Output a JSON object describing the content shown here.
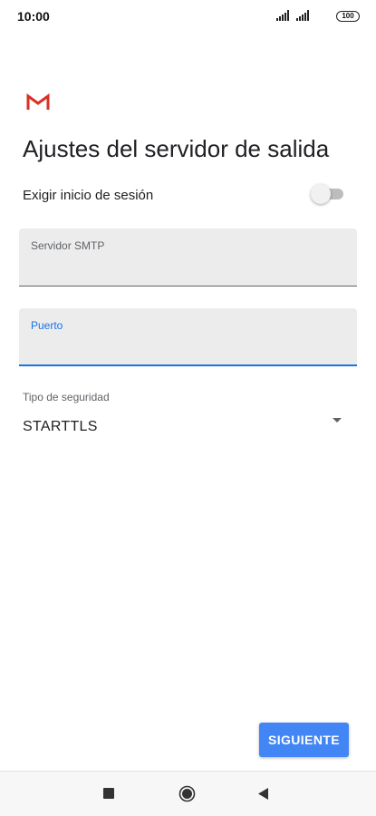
{
  "status_bar": {
    "time": "10:00",
    "battery": "100"
  },
  "icons": {
    "logo": "gmail-logo",
    "signal": "signal-icon",
    "battery": "battery-icon",
    "dropdown": "dropdown-arrow-icon",
    "nav_recent": "square-icon",
    "nav_home": "circle-icon",
    "nav_back": "triangle-back-icon"
  },
  "colors": {
    "accent": "#1a73e8",
    "button": "#4285f4",
    "gmail_red": "#d93025"
  },
  "header": {
    "title": "Ajustes del servidor de salida"
  },
  "login_toggle": {
    "label": "Exigir inicio de sesión",
    "enabled": false
  },
  "fields": {
    "smtp": {
      "label": "Servidor SMTP",
      "value": ""
    },
    "port": {
      "label": "Puerto",
      "value": ""
    }
  },
  "security": {
    "label": "Tipo de seguridad",
    "selected": "STARTTLS"
  },
  "actions": {
    "next_label": "SIGUIENTE"
  }
}
